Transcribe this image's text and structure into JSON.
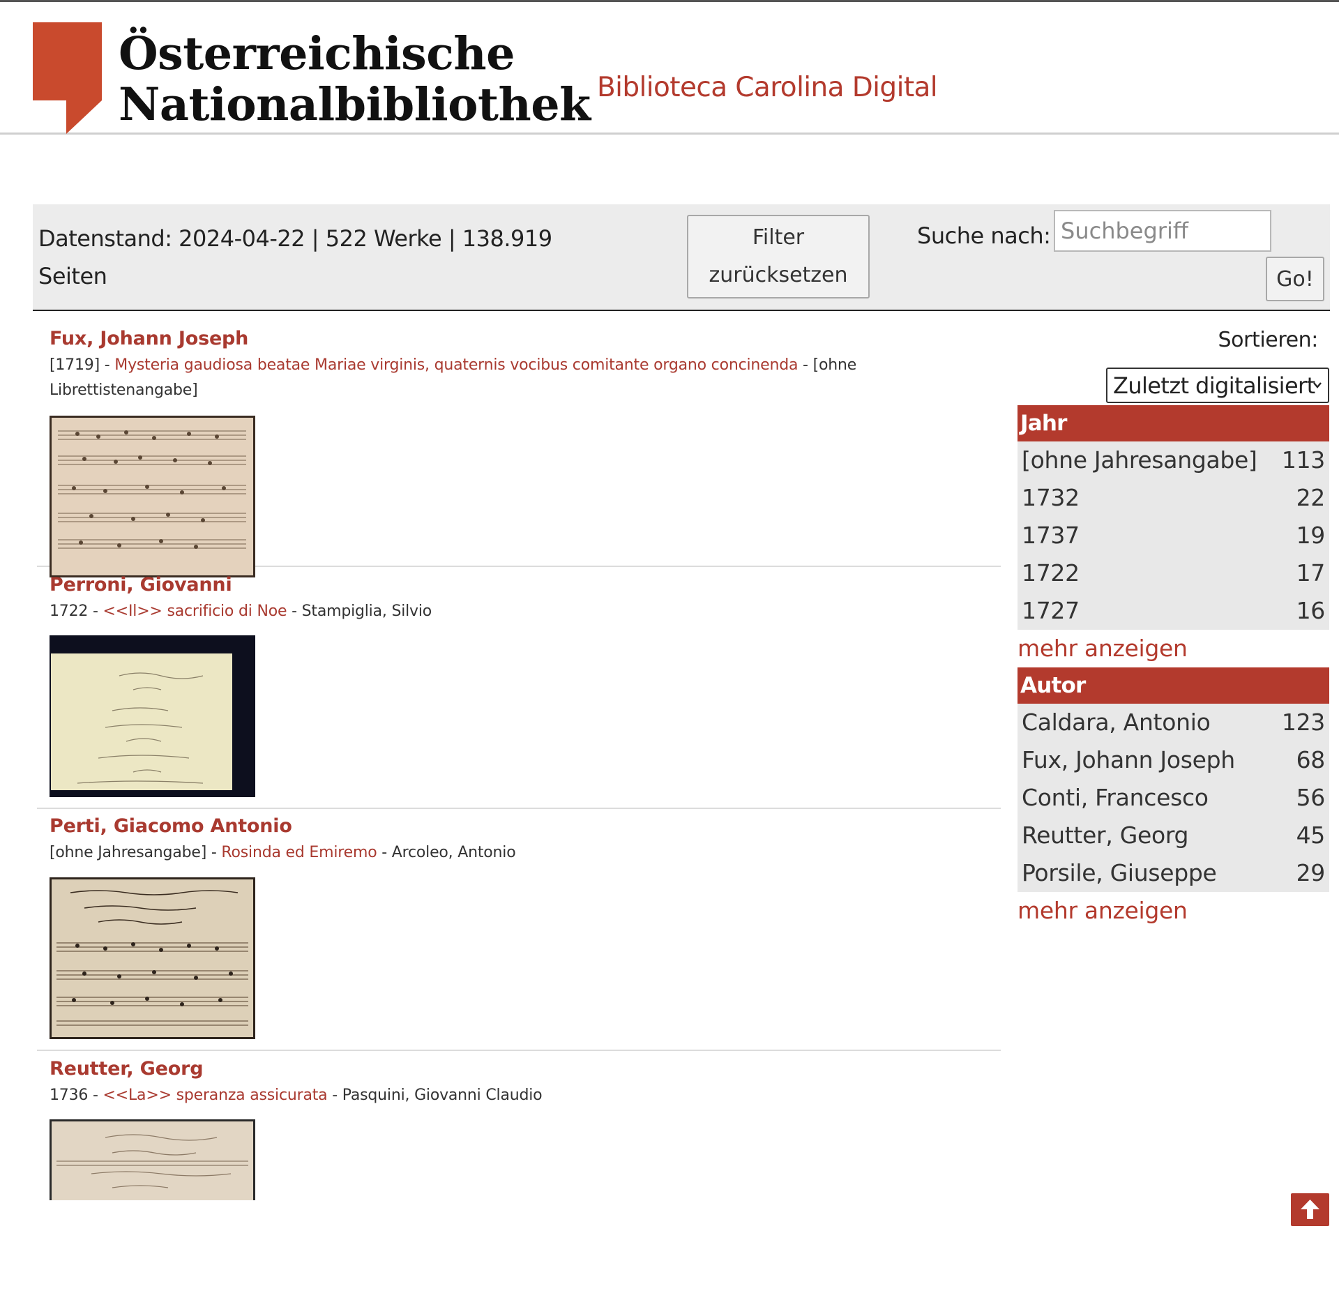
{
  "header": {
    "logo_line1": "Österreichische",
    "logo_line2": "Nationalbibliothek",
    "site_title": "Biblioteca Carolina Digital"
  },
  "filterbar": {
    "stats": "Datenstand: 2024-04-22 | 522 Werke | 138.919 Seiten",
    "reset_line1": "Filter",
    "reset_line2": "zurücksetzen",
    "search_label": "Suche nach:",
    "search_placeholder": "Suchbegriff",
    "search_value": "",
    "go_label": "Go!"
  },
  "results": [
    {
      "author": "Fux, Johann Joseph",
      "year": "[1719]",
      "title": "Mysteria gaudiosa beatae Mariae virginis, quaternis vocibus comitante organo concinenda",
      "librettist": "[ohne Librettistenangabe]"
    },
    {
      "author": "Perroni, Giovanni",
      "year": "1722",
      "title": "<<Il>> sacrificio di Noe",
      "librettist": "Stampiglia, Silvio"
    },
    {
      "author": "Perti, Giacomo Antonio",
      "year": "[ohne Jahresangabe]",
      "title": "Rosinda ed Emiremo",
      "librettist": "Arcoleo, Antonio"
    },
    {
      "author": "Reutter, Georg",
      "year": "1736",
      "title": "<<La>> speranza assicurata",
      "librettist": "Pasquini, Giovanni Claudio"
    }
  ],
  "sidebar": {
    "sort_label": "Sortieren:",
    "sort_selected": "Zuletzt digitalisiert",
    "facets": {
      "year": {
        "header": "Jahr",
        "items": [
          {
            "name": "[ohne Jahresangabe]",
            "count": "113"
          },
          {
            "name": "1732",
            "count": "22"
          },
          {
            "name": "1737",
            "count": "19"
          },
          {
            "name": "1722",
            "count": "17"
          },
          {
            "name": "1727",
            "count": "16"
          }
        ],
        "more": "mehr anzeigen"
      },
      "author": {
        "header": "Autor",
        "items": [
          {
            "name": "Caldara, Antonio",
            "count": "123"
          },
          {
            "name": "Fux, Johann Joseph",
            "count": "68"
          },
          {
            "name": "Conti, Francesco",
            "count": "56"
          },
          {
            "name": "Reutter, Georg",
            "count": "45"
          },
          {
            "name": "Porsile, Giuseppe",
            "count": "29"
          }
        ],
        "more": "mehr anzeigen"
      }
    }
  },
  "colors": {
    "accent": "#b33a2d",
    "link": "#a93a30",
    "bar_background": "#ececec",
    "facet_background": "#e8e8e8"
  },
  "icons": {
    "logo": "onb-logo-mark",
    "sort": "chevron-down-icon",
    "to_top": "arrow-up-icon"
  }
}
